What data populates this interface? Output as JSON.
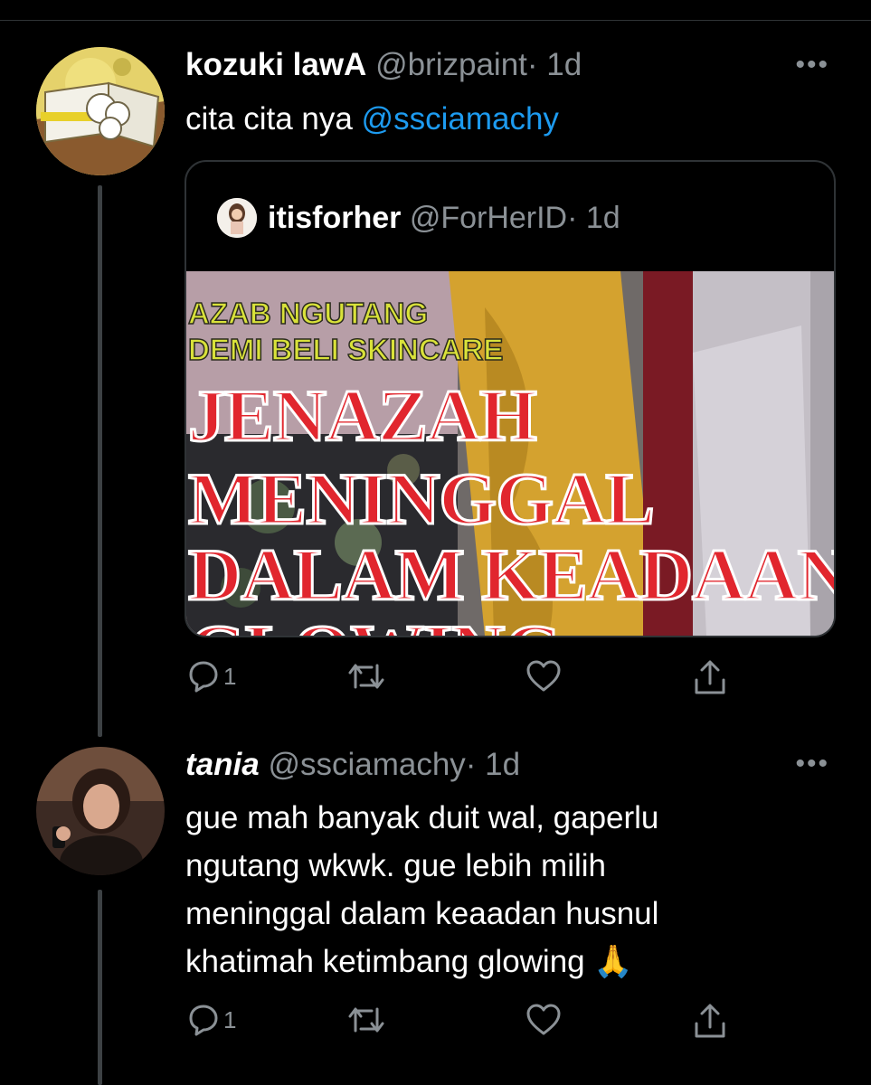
{
  "tweets": [
    {
      "name": "kozuki lawA",
      "handle": "@brizpaint",
      "time": "· 1d",
      "text_prefix": "cita cita nya ",
      "mention": "@ssciamachy",
      "quote": {
        "name": "itisforher",
        "handle": "@ForHerID",
        "time": "· 1d",
        "media_lines": [
          "AZAB NGUTANG",
          "DEMI BELI SKINCARE",
          "JENAZAH",
          "MENINGGAL",
          "DALAM KEADAAN",
          "GLOWING"
        ]
      },
      "reply_count": "1"
    },
    {
      "name": "tania",
      "handle": "@ssciamachy",
      "time": "· 1d",
      "text_lines": [
        "gue mah banyak duit wal, gaperlu",
        "ngutang wkwk. gue lebih milih",
        "meninggal dalam keaadan husnul",
        "khatimah ketimbang glowing"
      ],
      "emoji": "🙏",
      "reply_count": "1"
    }
  ],
  "more_label": "•••",
  "icons": [
    "reply-icon",
    "retweet-icon",
    "like-icon",
    "share-icon",
    "more-icon"
  ],
  "colors": {
    "background": "#000000",
    "mention": "#1d9bf0",
    "muted": "#8b9196",
    "headline_red": "#e1262e",
    "headline_yellow": "#d9e23a"
  }
}
